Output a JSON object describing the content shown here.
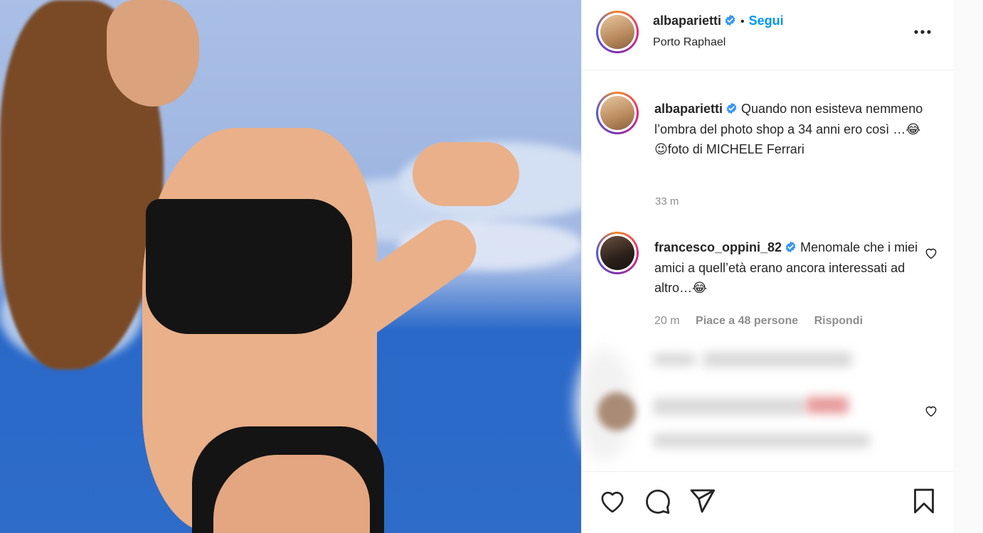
{
  "post": {
    "author": "albaparietti",
    "follow_label": "Segui",
    "separator": "•",
    "location": "Porto Raphael"
  },
  "caption": {
    "author": "albaparietti",
    "text": "Quando non esisteva nemmeno l’ombra del photo shop a 34 anni ero così …😂😉foto di MICHELE Ferrari",
    "time": "33 m"
  },
  "comments": [
    {
      "author": "francesco_oppini_82",
      "text": "Menomale che i miei amici a quell’età erano ancora interessati ad altro…😂",
      "time": "20 m",
      "likes": "Piace a 48 persone",
      "reply": "Rispondi"
    }
  ],
  "icons": {
    "verified": "verified-badge-icon",
    "more": "more-options-icon",
    "like": "heart-icon",
    "comment": "comment-icon",
    "share": "send-icon",
    "save": "bookmark-icon"
  },
  "colors": {
    "follow": "#0095f6",
    "verified": "#3897f0",
    "muted": "#8e8e8e"
  }
}
